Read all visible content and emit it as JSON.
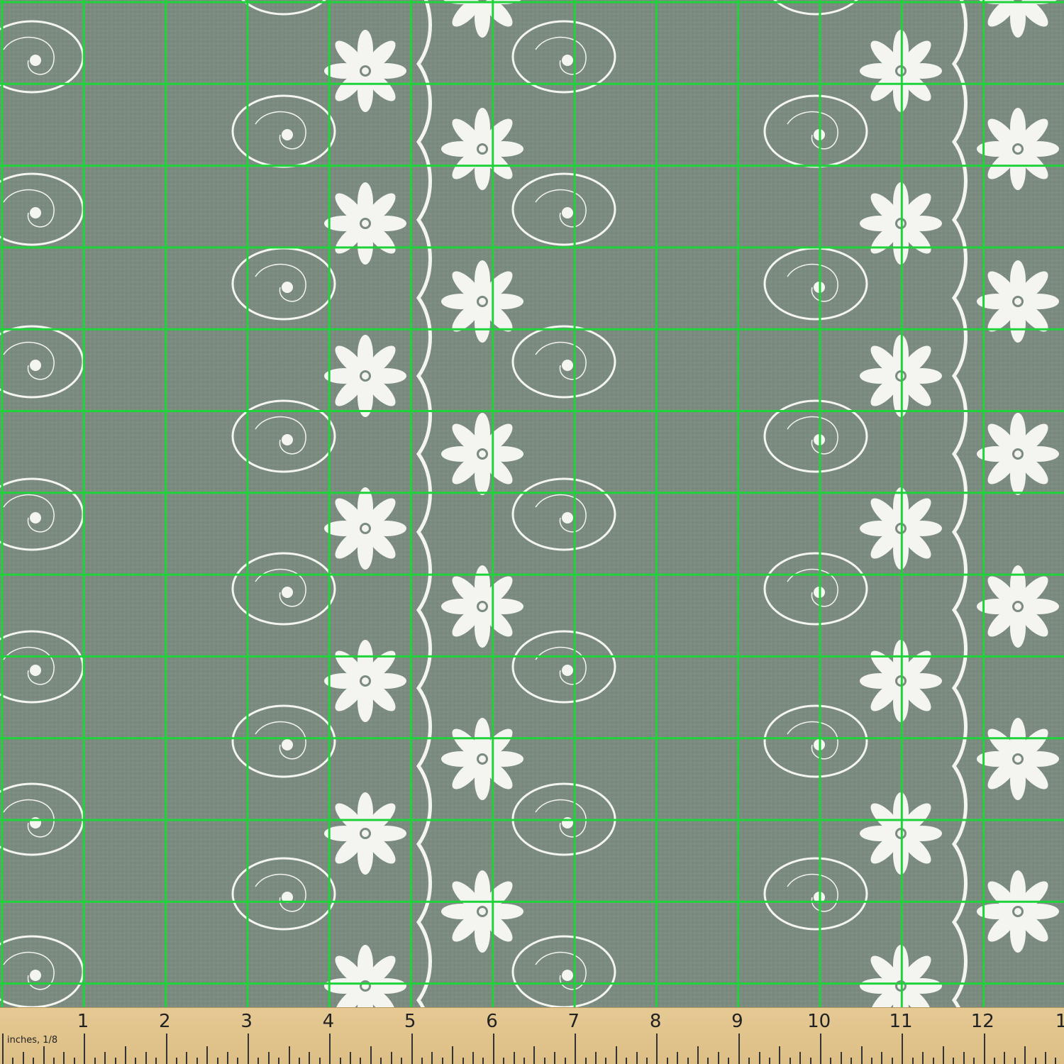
{
  "fabric": {
    "pattern": "white daisy flowers with wavy vines and swirls on sage grey",
    "background_color": "#7c8b80",
    "motif_color": "#f4f5f1",
    "grid_color": "#1fd43a"
  },
  "ruler": {
    "unit_label": "inches, 1/8",
    "numbers": [
      "1",
      "2",
      "3",
      "4",
      "5",
      "6",
      "7",
      "8",
      "9",
      "10",
      "11",
      "12",
      "1"
    ],
    "background_color": "#e2c58c"
  }
}
